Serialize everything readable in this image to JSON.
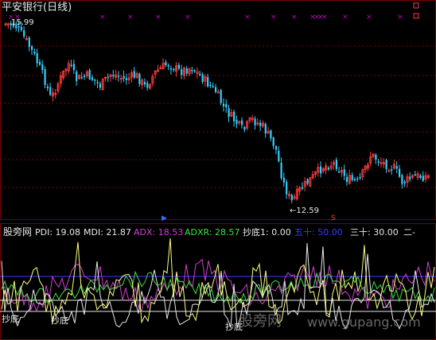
{
  "window": {
    "title": "平安银行(日线)"
  },
  "price_panel": {
    "high_label": "15.99",
    "low_label": "←12.59",
    "colors": {
      "up": "#ff3b3b",
      "down": "#32d0ff",
      "marker": "#c000c0",
      "grid": "#7a0000"
    }
  },
  "indicator": {
    "name": "股旁网",
    "legend": [
      {
        "text": "PDI: 19.08",
        "color": "#e8e8e8"
      },
      {
        "text": "MDI: 21.87",
        "color": "#e8e8e8"
      },
      {
        "text": "ADX: 18.53",
        "color": "#d040d0"
      },
      {
        "text": "ADXR: 28.57",
        "color": "#40e040"
      },
      {
        "text": "抄底1: 0.00",
        "color": "#e8e8e8"
      },
      {
        "text": "五十: 50.00",
        "color": "#3a3aff"
      },
      {
        "text": "三十: 30.00",
        "color": "#e8e8e8"
      },
      {
        "text": "二-",
        "color": "#e8e8e8"
      }
    ],
    "signal_labels": [
      "抄底",
      "抄底",
      "抄底"
    ],
    "series_colors": {
      "pdi": "#e8e8e8",
      "mdi": "#ffff80",
      "adx": "#d040d0",
      "adxr": "#40e040",
      "fifty": "#3a3aff",
      "thirty": "#e8e8e8"
    }
  },
  "watermark": {
    "cn": "股旁网",
    "url": "www.gupang.com"
  }
}
